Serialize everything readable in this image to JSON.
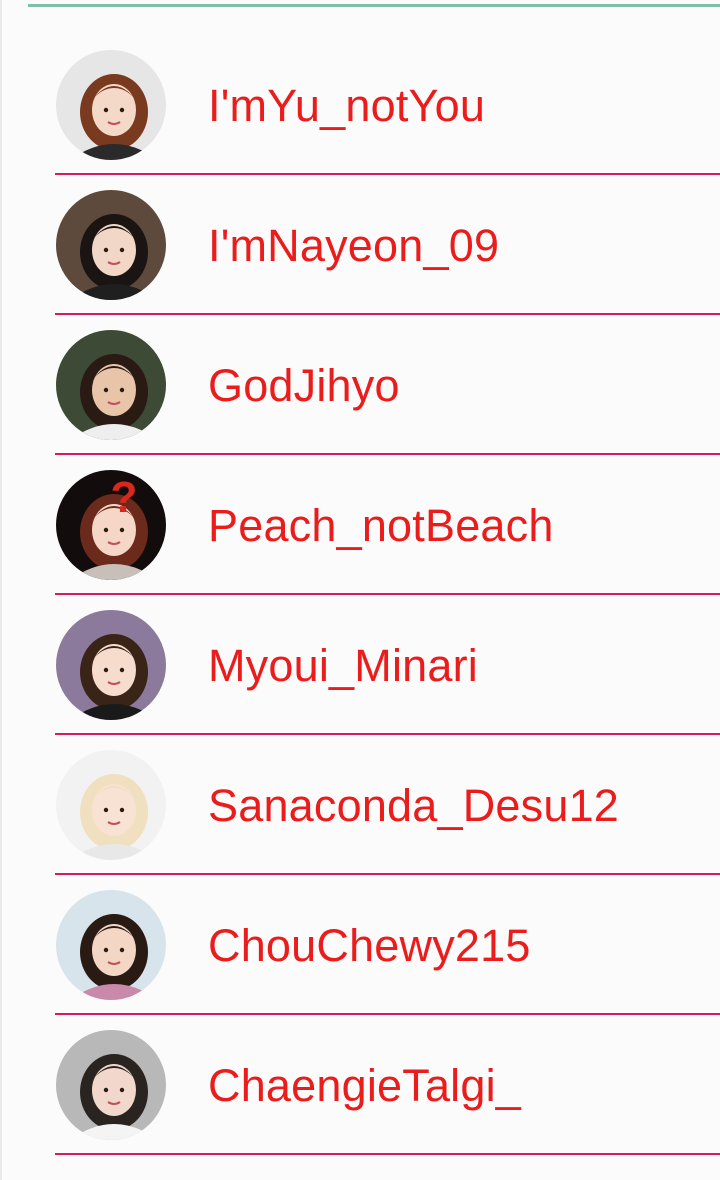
{
  "accent": "#ea1c1c",
  "divider_color": "#d81b60",
  "header_line_color": "#7fbfa8",
  "users": [
    {
      "username": "I'mYu_notYou",
      "avatar": {
        "icon": "user-avatar-icon",
        "bg": "#e6e6e6",
        "hair": "#7a3a1f",
        "skin": "#f4d9c8",
        "top": "#2a2a2a"
      }
    },
    {
      "username": "I'mNayeon_09",
      "avatar": {
        "icon": "user-avatar-icon",
        "bg": "#5d4a3c",
        "hair": "#1a1412",
        "skin": "#f2d6c6",
        "top": "#1f1f1f"
      }
    },
    {
      "username": "GodJihyo",
      "avatar": {
        "icon": "user-avatar-icon",
        "bg": "#3d4a36",
        "hair": "#2a1a14",
        "skin": "#e8c4a8",
        "top": "#eeeeee"
      }
    },
    {
      "username": "Peach_notBeach",
      "avatar": {
        "icon": "user-avatar-icon",
        "bg": "#130c0c",
        "hair": "#6b2a1c",
        "skin": "#f6d6c6",
        "top": "#c8c0b8",
        "badge": "?"
      }
    },
    {
      "username": "Myoui_Minari",
      "avatar": {
        "icon": "user-avatar-icon",
        "bg": "#8c7a9c",
        "hair": "#3a2418",
        "skin": "#f6dccc",
        "top": "#1a1a1a"
      }
    },
    {
      "username": "Sanaconda_Desu12",
      "avatar": {
        "icon": "user-avatar-icon",
        "bg": "#f2f2f2",
        "hair": "#f0e0c0",
        "skin": "#f8e2d4",
        "top": "#e8e8e8"
      }
    },
    {
      "username": "ChouChewy215",
      "avatar": {
        "icon": "user-avatar-icon",
        "bg": "#d8e4ec",
        "hair": "#2a1a14",
        "skin": "#f4d6c4",
        "top": "#c88aa8"
      }
    },
    {
      "username": "ChaengieTalgi_",
      "avatar": {
        "icon": "user-avatar-icon",
        "bg": "#b8b8b8",
        "hair": "#2a2420",
        "skin": "#f2d8cc",
        "top": "#f4f4f4"
      }
    }
  ]
}
